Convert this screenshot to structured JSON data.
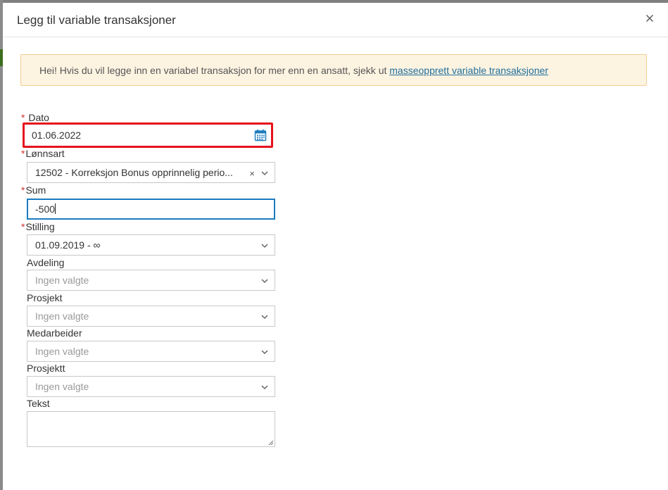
{
  "modal": {
    "title": "Legg til variable transaksjoner",
    "close_icon": "close-icon"
  },
  "notice": {
    "text": "Hei! Hvis du vil legge inn en variabel transaksjon for mer enn en ansatt, sjekk ut ",
    "link": "masseopprett variable transaksjoner"
  },
  "form": {
    "required_mark": "*",
    "dato": {
      "label": "Dato",
      "value": "01.06.2022",
      "icon": "calendar-icon"
    },
    "lonnsart": {
      "label": "Lønnsart",
      "value": "12502 - Korreksjon Bonus opprinnelig perio...",
      "clear": "×"
    },
    "sum": {
      "label": "Sum",
      "value": "-500"
    },
    "stilling": {
      "label": "Stilling",
      "value": "01.09.2019 - ∞"
    },
    "avdeling": {
      "label": "Avdeling",
      "placeholder": "Ingen valgte"
    },
    "prosjekt": {
      "label": "Prosjekt",
      "placeholder": "Ingen valgte"
    },
    "medarbeider": {
      "label": "Medarbeider",
      "placeholder": "Ingen valgte"
    },
    "prosjektt": {
      "label": "Prosjektt",
      "placeholder": "Ingen valgte"
    },
    "tekst": {
      "label": "Tekst",
      "value": ""
    }
  },
  "colors": {
    "required": "#d0342c",
    "highlight": "#e5111c",
    "focus": "#1b7bbf",
    "notice_bg": "#fdf3e1",
    "link": "#1f6f9c"
  }
}
